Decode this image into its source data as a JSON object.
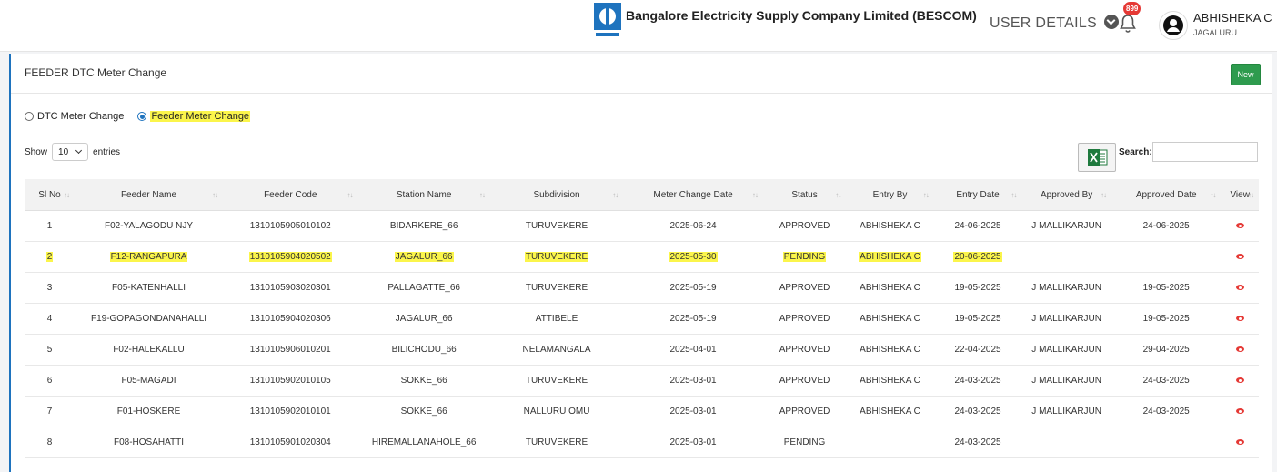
{
  "header": {
    "company_name": "Bangalore Electricity Supply Company Limited (BESCOM)",
    "user_details_label": "USER DETAILS",
    "notification_count": "899",
    "user_name": "ABHISHEKA C",
    "user_location": "JAGALURU"
  },
  "card": {
    "title": "FEEDER DTC Meter Change",
    "new_label": "New"
  },
  "radios": [
    {
      "label": "DTC Meter Change",
      "checked": false
    },
    {
      "label": "Feeder Meter Change",
      "checked": true
    }
  ],
  "controls": {
    "show_label": "Show",
    "entries_value": "10",
    "entries_label": "entries",
    "search_label": "Search:"
  },
  "table": {
    "headers": [
      "Sl No",
      "Feeder Name",
      "Feeder Code",
      "Station Name",
      "Subdivision",
      "Meter Change Date",
      "Status",
      "Entry By",
      "Entry Date",
      "Approved By",
      "Approved Date",
      "View"
    ],
    "rows": [
      [
        "1",
        "F02-YALAGODU NJY",
        "1310105905010102",
        "BIDARKERE_66",
        "TURUVEKERE",
        "2025-06-24",
        "APPROVED",
        "ABHISHEKA C",
        "24-06-2025",
        "J MALLIKARJUN",
        "24-06-2025"
      ],
      [
        "2",
        "F12-RANGAPURA",
        "1310105904020502",
        "JAGALUR_66",
        "TURUVEKERE",
        "2025-05-30",
        "PENDING",
        "ABHISHEKA C",
        "20-06-2025",
        "",
        ""
      ],
      [
        "3",
        "F05-KATENHALLI",
        "1310105903020301",
        "PALLAGATTE_66",
        "TURUVEKERE",
        "2025-05-19",
        "APPROVED",
        "ABHISHEKA C",
        "19-05-2025",
        "J MALLIKARJUN",
        "19-05-2025"
      ],
      [
        "4",
        "F19-GOPAGONDANAHALLI",
        "1310105904020306",
        "JAGALUR_66",
        "ATTIBELE",
        "2025-05-19",
        "APPROVED",
        "ABHISHEKA C",
        "19-05-2025",
        "J MALLIKARJUN",
        "19-05-2025"
      ],
      [
        "5",
        "F02-HALEKALLU",
        "1310105906010201",
        "BILICHODU_66",
        "NELAMANGALA",
        "2025-04-01",
        "APPROVED",
        "ABHISHEKA C",
        "22-04-2025",
        "J MALLIKARJUN",
        "29-04-2025"
      ],
      [
        "6",
        "F05-MAGADI",
        "1310105902010105",
        "SOKKE_66",
        "TURUVEKERE",
        "2025-03-01",
        "APPROVED",
        "ABHISHEKA C",
        "24-03-2025",
        "J MALLIKARJUN",
        "24-03-2025"
      ],
      [
        "7",
        "F01-HOSKERE",
        "1310105902010101",
        "SOKKE_66",
        "NALLURU OMU",
        "2025-03-01",
        "APPROVED",
        "ABHISHEKA C",
        "24-03-2025",
        "J MALLIKARJUN",
        "24-03-2025"
      ],
      [
        "8",
        "F08-HOSAHATTI",
        "1310105901020304",
        "HIREMALLANAHOLE_66",
        "TURUVEKERE",
        "2025-03-01",
        "PENDING",
        "",
        "24-03-2025",
        "",
        ""
      ]
    ]
  },
  "colors": {
    "accent": "#1e73be",
    "new_button": "#2e9b4e",
    "view_icon": "#e53935",
    "highlight": "#fbf54b",
    "badge": "#e53935"
  }
}
